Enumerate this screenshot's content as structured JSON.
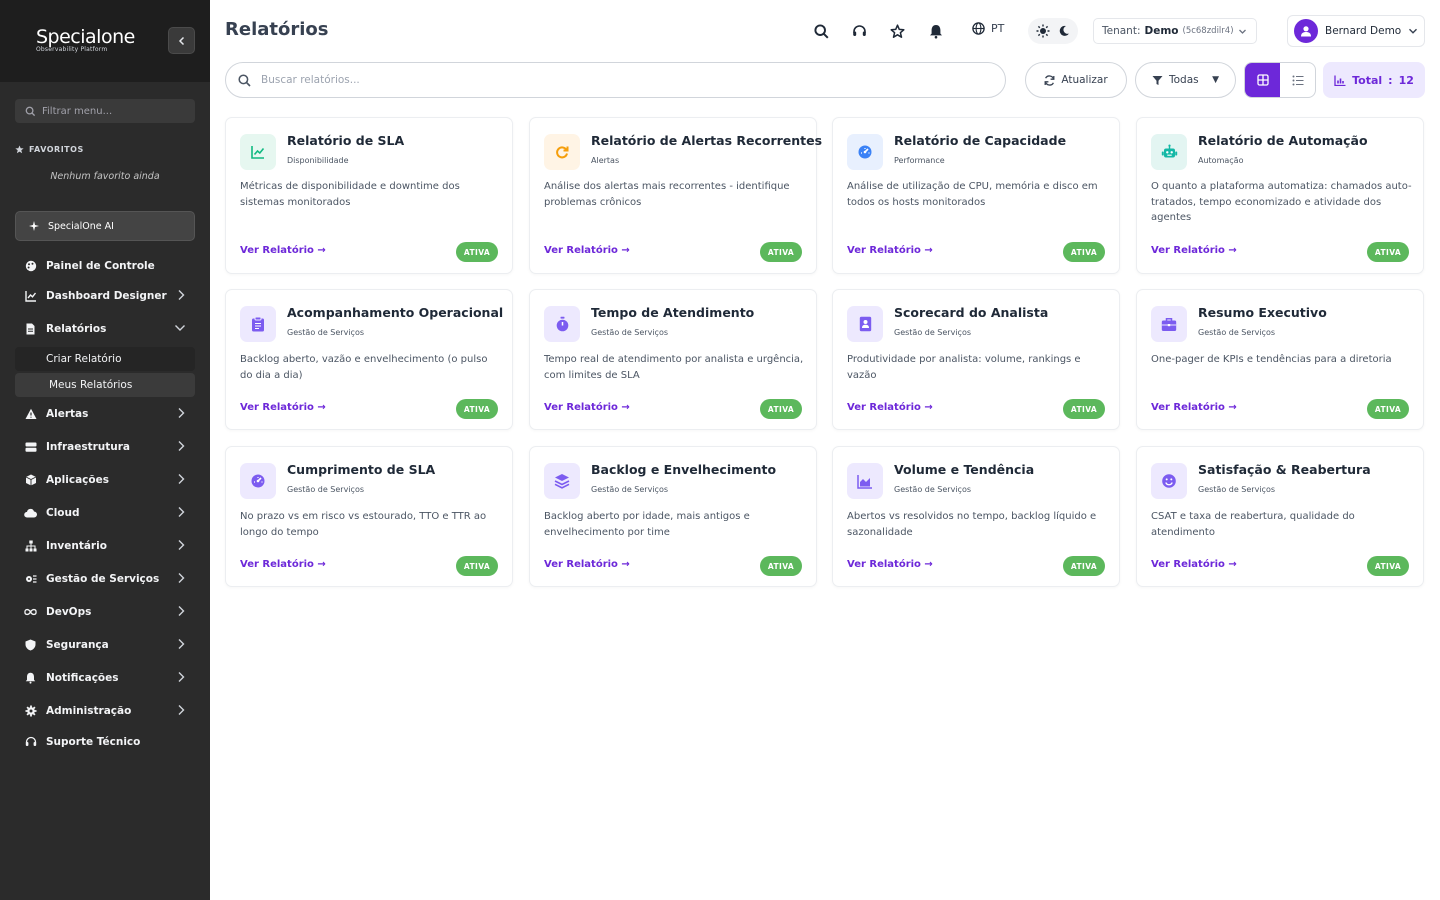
{
  "sidebar": {
    "logo_name": "Specialone",
    "logo_sub": "Observability Platform",
    "filter_placeholder": "Filtrar menu...",
    "favorites_title": "FAVORITOS",
    "favorites_empty": "Nenhum favorito ainda",
    "ai_label": "SpecialOne AI",
    "items": [
      {
        "label": "Painel de Controle",
        "icon": "palette-icon"
      },
      {
        "label": "Dashboard Designer",
        "icon": "chart-line-icon"
      },
      {
        "label": "Relatórios",
        "icon": "file-icon"
      },
      {
        "label": "Criar Relatório"
      },
      {
        "label": "Meus Relatórios"
      },
      {
        "label": "Alertas",
        "icon": "warning-icon"
      },
      {
        "label": "Infraestrutura",
        "icon": "server-icon"
      },
      {
        "label": "Aplicações",
        "icon": "cube-icon"
      },
      {
        "label": "Cloud",
        "icon": "cloud-icon"
      },
      {
        "label": "Inventário",
        "icon": "sitemap-icon"
      },
      {
        "label": "Gestão de Serviços",
        "icon": "gear-list-icon"
      },
      {
        "label": "DevOps",
        "icon": "infinity-icon"
      },
      {
        "label": "Segurança",
        "icon": "shield-icon"
      },
      {
        "label": "Notificações",
        "icon": "bell-icon"
      },
      {
        "label": "Administração",
        "icon": "gear-icon"
      },
      {
        "label": "Suporte Técnico",
        "icon": "headset-icon"
      }
    ]
  },
  "header": {
    "title": "Relatórios",
    "language": "PT",
    "tenant_label": "Tenant:",
    "tenant_name": "Demo",
    "tenant_id": "(5c68zdilr4)",
    "user_name": "Bernard Demo"
  },
  "toolbar": {
    "search_placeholder": "Buscar relatórios...",
    "refresh_label": "Atualizar",
    "filter_label": "Todas",
    "total_label": "Total",
    "total_sep": ":",
    "total_value": "12"
  },
  "colors": {
    "accent": "#6d28d9",
    "badge": "#5cb85c",
    "sidebar_bg": "#2b2b2b"
  },
  "cards": [
    {
      "title": "Relatório de SLA",
      "category": "Disponibilidade",
      "description": "Métricas de disponibilidade e downtime dos sistemas monitorados",
      "link": "Ver Relatório →",
      "badge": "ATIVA",
      "icon": "chart-line-icon"
    },
    {
      "title": "Relatório de Alertas Recorrentes",
      "category": "Alertas",
      "description": "Análise dos alertas mais recorrentes - identifique problemas crônicos",
      "link": "Ver Relatório →",
      "badge": "ATIVA",
      "icon": "redo-icon"
    },
    {
      "title": "Relatório de Capacidade",
      "category": "Performance",
      "description": "Análise de utilização de CPU, memória e disco em todos os hosts monitorados",
      "link": "Ver Relatório →",
      "badge": "ATIVA",
      "icon": "gauge-icon"
    },
    {
      "title": "Relatório de Automação",
      "category": "Automação",
      "description": "O quanto a plataforma automatiza: chamados auto-tratados, tempo economizado e atividade dos agentes",
      "link": "Ver Relatório →",
      "badge": "ATIVA",
      "icon": "robot-icon"
    },
    {
      "title": "Acompanhamento Operacional",
      "category": "Gestão de Serviços",
      "description": "Backlog aberto, vazão e envelhecimento (o pulso do dia a dia)",
      "link": "Ver Relatório →",
      "badge": "ATIVA",
      "icon": "clipboard-icon"
    },
    {
      "title": "Tempo de Atendimento",
      "category": "Gestão de Serviços",
      "description": "Tempo real de atendimento por analista e urgência, com limites de SLA",
      "link": "Ver Relatório →",
      "badge": "ATIVA",
      "icon": "stopwatch-icon"
    },
    {
      "title": "Scorecard do Analista",
      "category": "Gestão de Serviços",
      "description": "Produtividade por analista: volume, rankings e vazão",
      "link": "Ver Relatório →",
      "badge": "ATIVA",
      "icon": "id-badge-icon"
    },
    {
      "title": "Resumo Executivo",
      "category": "Gestão de Serviços",
      "description": "One-pager de KPIs e tendências para a diretoria",
      "link": "Ver Relatório →",
      "badge": "ATIVA",
      "icon": "briefcase-icon"
    },
    {
      "title": "Cumprimento de SLA",
      "category": "Gestão de Serviços",
      "description": "No prazo vs em risco vs estourado, TTO e TTR ao longo do tempo",
      "link": "Ver Relatório →",
      "badge": "ATIVA",
      "icon": "gauge-icon"
    },
    {
      "title": "Backlog e Envelhecimento",
      "category": "Gestão de Serviços",
      "description": "Backlog aberto por idade, mais antigos e envelhecimento por time",
      "link": "Ver Relatório →",
      "badge": "ATIVA",
      "icon": "layers-icon"
    },
    {
      "title": "Volume e Tendência",
      "category": "Gestão de Serviços",
      "description": "Abertos vs resolvidos no tempo, backlog líquido e sazonalidade",
      "link": "Ver Relatório →",
      "badge": "ATIVA",
      "icon": "area-chart-icon"
    },
    {
      "title": "Satisfação & Reabertura",
      "category": "Gestão de Serviços",
      "description": "CSAT e taxa de reabertura, qualidade do atendimento",
      "link": "Ver Relatório →",
      "badge": "ATIVA",
      "icon": "smile-icon"
    }
  ]
}
